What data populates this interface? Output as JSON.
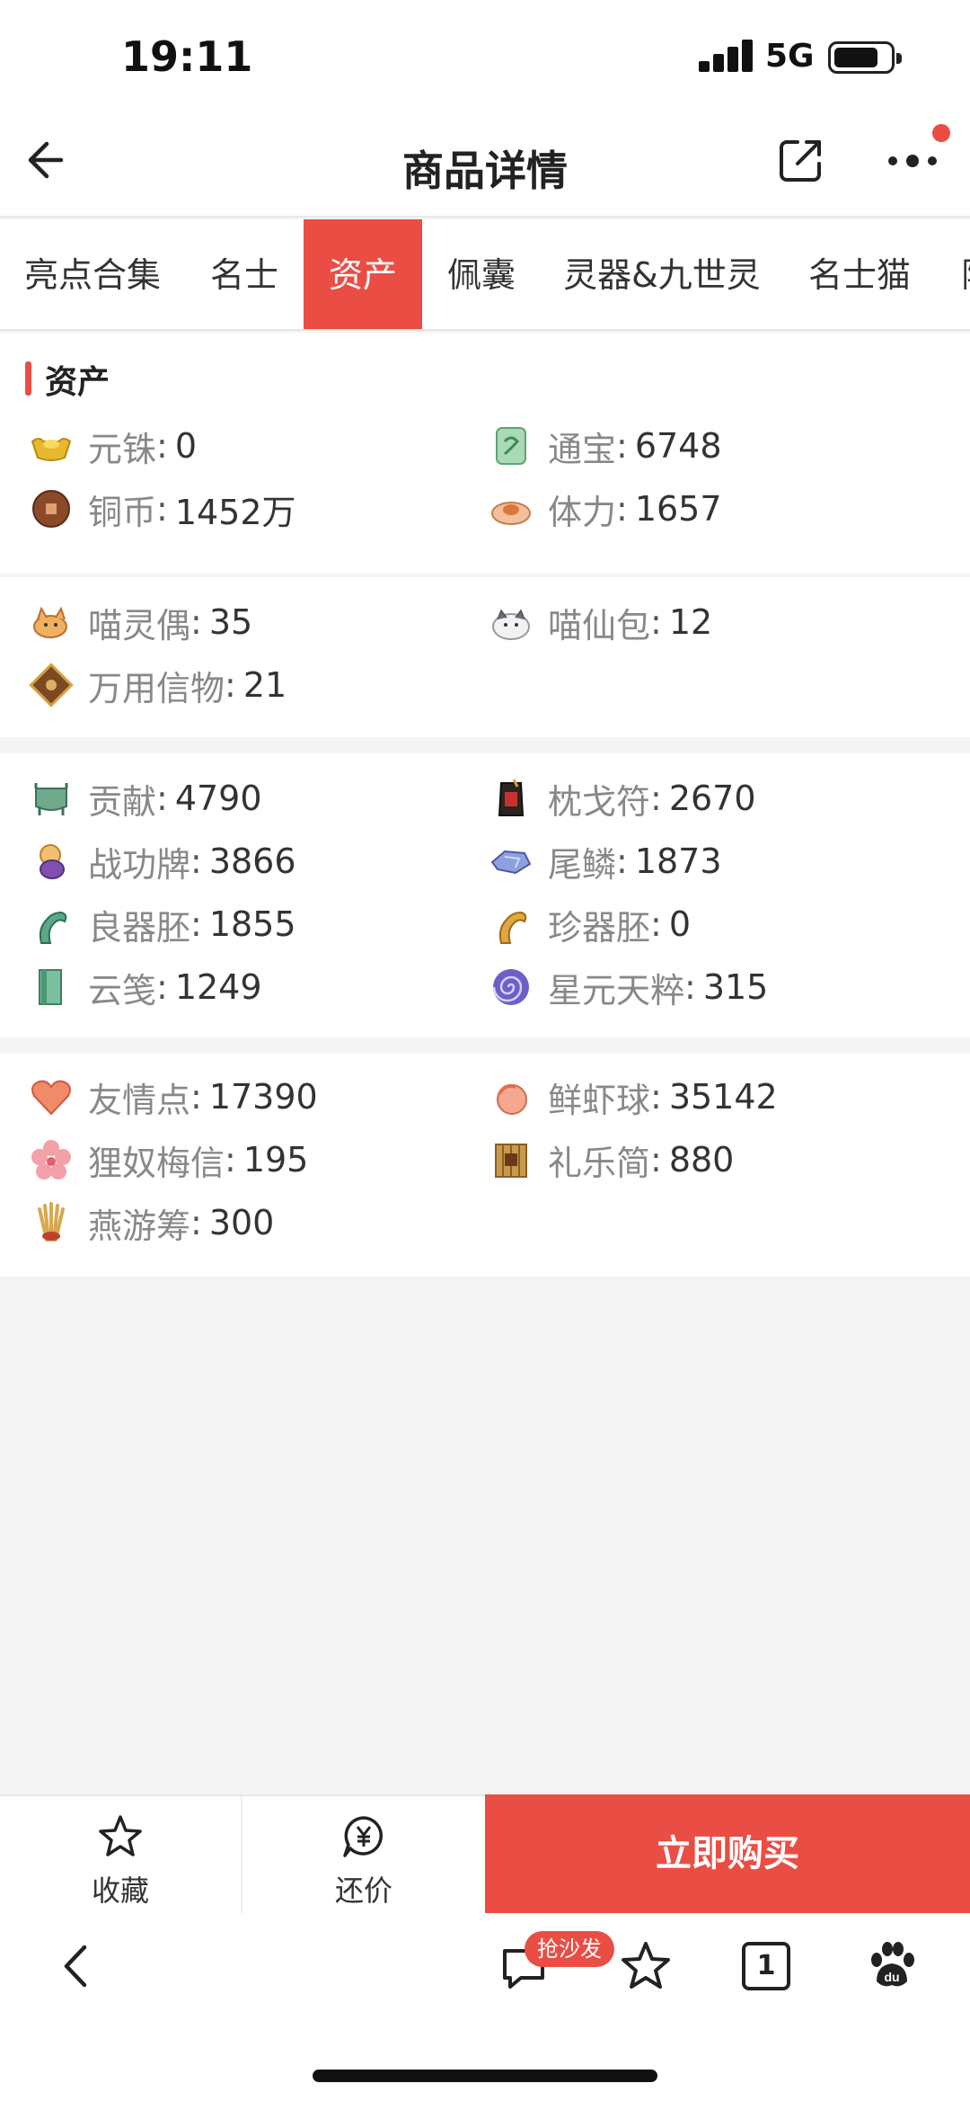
{
  "status": {
    "time": "19:11",
    "network": "5G"
  },
  "header": {
    "title": "商品详情"
  },
  "tabs": [
    {
      "label": "亮点合集",
      "active": false
    },
    {
      "label": "名士",
      "active": false
    },
    {
      "label": "资产",
      "active": true
    },
    {
      "label": "佩囊",
      "active": false
    },
    {
      "label": "灵器&九世灵",
      "active": false
    },
    {
      "label": "名士猫",
      "active": false
    },
    {
      "label": "阵",
      "active": false
    }
  ],
  "assets": {
    "section_title": "资产",
    "group1": [
      {
        "label": "元铢",
        "value": "0",
        "icon": "gold-ingot-icon"
      },
      {
        "label": "通宝",
        "value": "6748",
        "icon": "jade-token-icon"
      },
      {
        "label": "铜币",
        "value": "1452万",
        "icon": "copper-coin-icon"
      },
      {
        "label": "体力",
        "value": "1657",
        "icon": "bun-stamina-icon"
      }
    ],
    "group2": [
      {
        "label": "喵灵偶",
        "value": "35",
        "icon": "cat-doll-icon"
      },
      {
        "label": "喵仙包",
        "value": "12",
        "icon": "cat-bun-icon"
      },
      {
        "label": "万用信物",
        "value": "21",
        "icon": "universal-token-icon"
      }
    ],
    "group3": [
      {
        "label": "贡献",
        "value": "4790",
        "icon": "cauldron-icon"
      },
      {
        "label": "枕戈符",
        "value": "2670",
        "icon": "talisman-icon"
      },
      {
        "label": "战功牌",
        "value": "3866",
        "icon": "merit-plaque-icon"
      },
      {
        "label": "尾鳞",
        "value": "1873",
        "icon": "scale-icon"
      },
      {
        "label": "良器胚",
        "value": "1855",
        "icon": "green-embryo-icon"
      },
      {
        "label": "珍器胚",
        "value": "0",
        "icon": "gold-embryo-icon"
      },
      {
        "label": "云笺",
        "value": "1249",
        "icon": "cloud-letter-icon"
      },
      {
        "label": "星元天粹",
        "value": "315",
        "icon": "star-vortex-icon"
      }
    ],
    "group4": [
      {
        "label": "友情点",
        "value": "17390",
        "icon": "heart-icon"
      },
      {
        "label": "鲜虾球",
        "value": "35142",
        "icon": "shrimp-ball-icon"
      },
      {
        "label": "狸奴梅信",
        "value": "195",
        "icon": "plum-blossom-icon"
      },
      {
        "label": "礼乐简",
        "value": "880",
        "icon": "bamboo-slip-icon"
      },
      {
        "label": "燕游筹",
        "value": "300",
        "icon": "tally-sticks-icon"
      }
    ]
  },
  "actions": {
    "favorite_label": "收藏",
    "bargain_label": "还价",
    "buy_label": "立即购买"
  },
  "browser": {
    "badge": "抢沙发",
    "tab_count": "1"
  }
}
